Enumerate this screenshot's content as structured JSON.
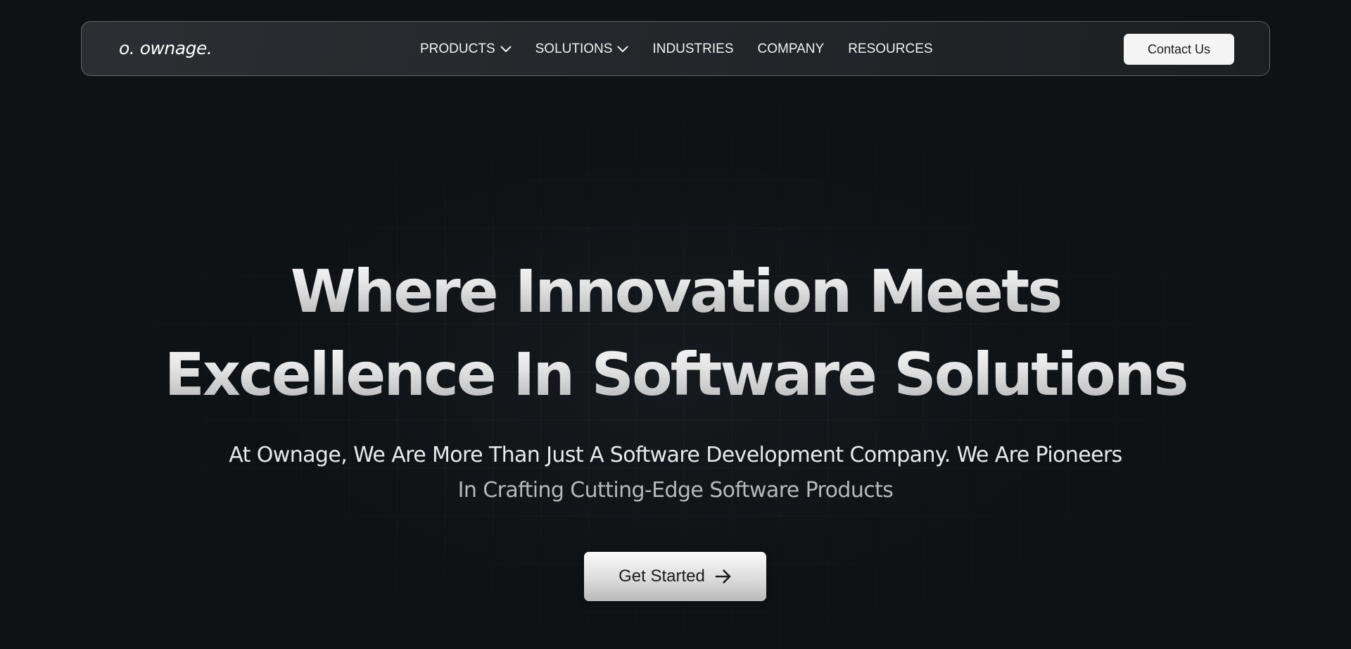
{
  "brand": {
    "logo_text": "o. ownage."
  },
  "nav": {
    "items": [
      {
        "label": "PRODUCTS",
        "has_dropdown": true
      },
      {
        "label": "SOLUTIONS",
        "has_dropdown": true
      },
      {
        "label": "INDUSTRIES",
        "has_dropdown": false
      },
      {
        "label": "COMPANY",
        "has_dropdown": false
      },
      {
        "label": "RESOURCES",
        "has_dropdown": false
      }
    ],
    "contact_label": "Contact Us"
  },
  "hero": {
    "title_line1": "Where Innovation Meets",
    "title_line2": "Excellence In Software Solutions",
    "subtitle_line1": "At Ownage, We Are More Than Just A Software Development Company. We Are Pioneers",
    "subtitle_line2": "In Crafting Cutting-Edge Software Products",
    "cta_label": "Get Started",
    "cta_icon": "arrow-right-icon"
  },
  "colors": {
    "background": "#0f1215",
    "navbar_bg": "#2b2e32",
    "button_bg": "#f4f4f4",
    "text_primary": "#ffffff"
  }
}
